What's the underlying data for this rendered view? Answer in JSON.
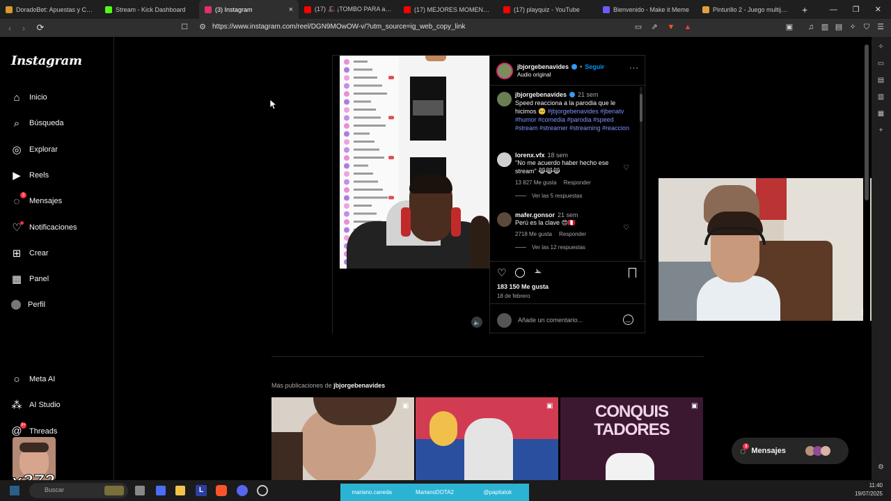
{
  "browser": {
    "tabs": [
      {
        "title": "DoradoBet: Apuestas y Casino",
        "color": "#d89a2b"
      },
      {
        "title": "Stream - Kick Dashboard",
        "color": "#53fc18"
      },
      {
        "title": "(3) Instagram",
        "color": "#e1306c",
        "active": true
      },
      {
        "title": "(17) 🎩 ¡TOMBO PARA a Daan",
        "color": "#ff0000"
      },
      {
        "title": "(17) MEJORES MOMENTOS KC",
        "color": "#ff0000"
      },
      {
        "title": "(17) playquiz - YouTube",
        "color": "#ff0000"
      },
      {
        "title": "Bienvenido - Make it Meme",
        "color": "#6a5cff"
      },
      {
        "title": "Pinturillo 2 - Juego multijugador",
        "color": "#e0a13a"
      }
    ],
    "url": "https://www.instagram.com/reel/DGN9MOwOW-v/?utm_source=ig_web_copy_link"
  },
  "ig": {
    "logo": "Instagram",
    "nav": [
      {
        "label": "Inicio",
        "icon": "home-icon"
      },
      {
        "label": "Búsqueda",
        "icon": "search-icon"
      },
      {
        "label": "Explorar",
        "icon": "compass-icon"
      },
      {
        "label": "Reels",
        "icon": "reels-icon"
      },
      {
        "label": "Mensajes",
        "icon": "messenger-icon",
        "badge": "3"
      },
      {
        "label": "Notificaciones",
        "icon": "heart-icon",
        "dot": true
      },
      {
        "label": "Crear",
        "icon": "plus-square-icon"
      },
      {
        "label": "Panel",
        "icon": "chart-icon"
      },
      {
        "label": "Perfil",
        "icon": "avatar-icon"
      }
    ],
    "nav_bottom": [
      {
        "label": "Meta AI",
        "icon": "meta-ai-icon"
      },
      {
        "label": "AI Studio",
        "icon": "ai-studio-icon"
      },
      {
        "label": "Threads",
        "icon": "threads-icon",
        "badge": "9+"
      }
    ]
  },
  "post": {
    "author": "jbjorgebenavides",
    "follow": "Seguir",
    "dot": "•",
    "audio": "Audio original",
    "caption_time": "21 sem",
    "caption_text": "Speed reacciona a la parodia que le hicimos 🥺",
    "caption_tags": "#jbjorgebenavides #jbenatv #humor #comedia #parodia #speed #stream #streamer #streaming #reaccion",
    "comments": [
      {
        "user": "lorenx.vfx",
        "time": "18 sem",
        "text": "\"No me acuerdo haber hecho ese stream\" 😹😹😹",
        "likes": "13 827 Me gusta",
        "reply": "Responder",
        "view": "Ver las 5 respuestas"
      },
      {
        "user": "mafer.gonsor",
        "time": "21 sem",
        "text": "Perú es la clave 😍🇵🇪",
        "likes": "2718 Me gusta",
        "reply": "Responder",
        "view": "Ver las 12 respuestas"
      }
    ],
    "likes": "183 150 Me gusta",
    "date": "18 de febrero",
    "comment_placeholder": "Añade un comentario..."
  },
  "more": {
    "prefix": "Más publicaciones de",
    "user": "jbjorgebenavides"
  },
  "thumbs": [
    {
      "text": ""
    },
    {
      "text": ""
    },
    {
      "text": "CONQUIS TADORES"
    }
  ],
  "messages_pill": {
    "label": "Mensajes",
    "badge": "3"
  },
  "overlay_text": "x372",
  "cam_label": "1X",
  "taskbar": {
    "search": "Buscar",
    "social": [
      "mariano.caneda",
      "MarianoDOTA2",
      "@papitatok"
    ],
    "time": "11:40",
    "date": "19/07/2025"
  }
}
